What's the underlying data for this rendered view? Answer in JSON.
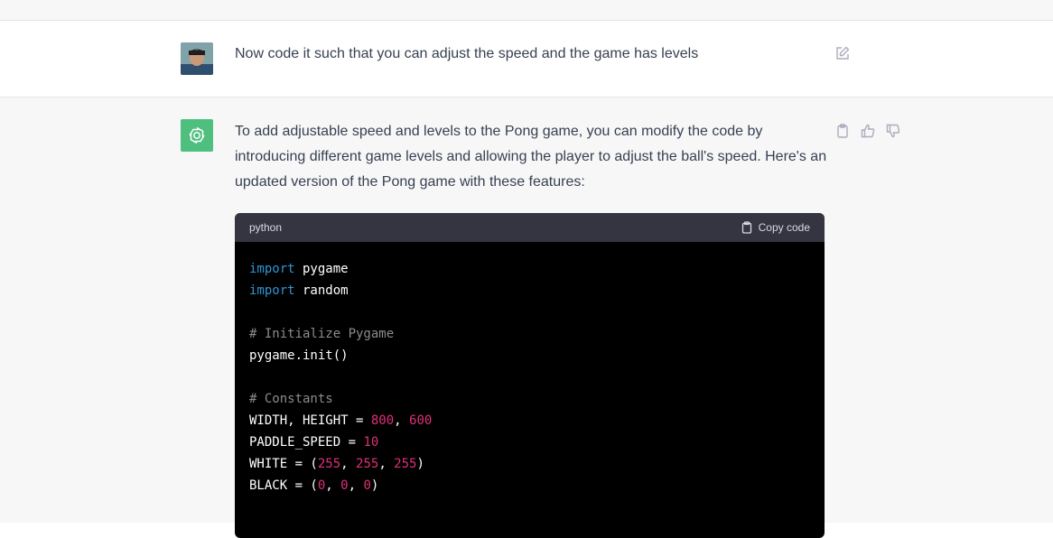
{
  "conversation": {
    "user_message": "Now code it such that you can adjust the speed and the game has levels",
    "assistant_intro": "To add adjustable speed and levels to the Pong game, you can modify the code by introducing different game levels and allowing the player to adjust the ball's speed. Here's an updated version of the Pong game with these features:"
  },
  "code_block": {
    "language": "python",
    "copy_label": "Copy code",
    "lines": [
      [
        {
          "t": "import",
          "c": "kw"
        },
        {
          "t": " pygame",
          "c": ""
        }
      ],
      [
        {
          "t": "import",
          "c": "kw"
        },
        {
          "t": " random",
          "c": ""
        }
      ],
      [],
      [
        {
          "t": "# Initialize Pygame",
          "c": "cm"
        }
      ],
      [
        {
          "t": "pygame.init()",
          "c": ""
        }
      ],
      [],
      [
        {
          "t": "# Constants",
          "c": "cm"
        }
      ],
      [
        {
          "t": "WIDTH, HEIGHT = ",
          "c": ""
        },
        {
          "t": "800",
          "c": "num"
        },
        {
          "t": ", ",
          "c": ""
        },
        {
          "t": "600",
          "c": "num"
        }
      ],
      [
        {
          "t": "PADDLE_SPEED = ",
          "c": ""
        },
        {
          "t": "10",
          "c": "num"
        }
      ],
      [
        {
          "t": "WHITE = (",
          "c": ""
        },
        {
          "t": "255",
          "c": "num"
        },
        {
          "t": ", ",
          "c": ""
        },
        {
          "t": "255",
          "c": "num"
        },
        {
          "t": ", ",
          "c": ""
        },
        {
          "t": "255",
          "c": "num"
        },
        {
          "t": ")",
          "c": ""
        }
      ],
      [
        {
          "t": "BLACK = (",
          "c": ""
        },
        {
          "t": "0",
          "c": "num"
        },
        {
          "t": ", ",
          "c": ""
        },
        {
          "t": "0",
          "c": "num"
        },
        {
          "t": ", ",
          "c": ""
        },
        {
          "t": "0",
          "c": "num"
        },
        {
          "t": ")",
          "c": ""
        }
      ]
    ]
  },
  "icons": {
    "edit": "edit-icon",
    "copy": "clipboard-icon",
    "thumbs_up": "thumbs-up-icon",
    "thumbs_down": "thumbs-down-icon",
    "bot": "openai-logo-icon"
  },
  "colors": {
    "assistant_avatar_bg": "#4fbf7f",
    "keyword": "#2e95d3",
    "comment": "#8c8c8c",
    "number": "#df3079"
  }
}
